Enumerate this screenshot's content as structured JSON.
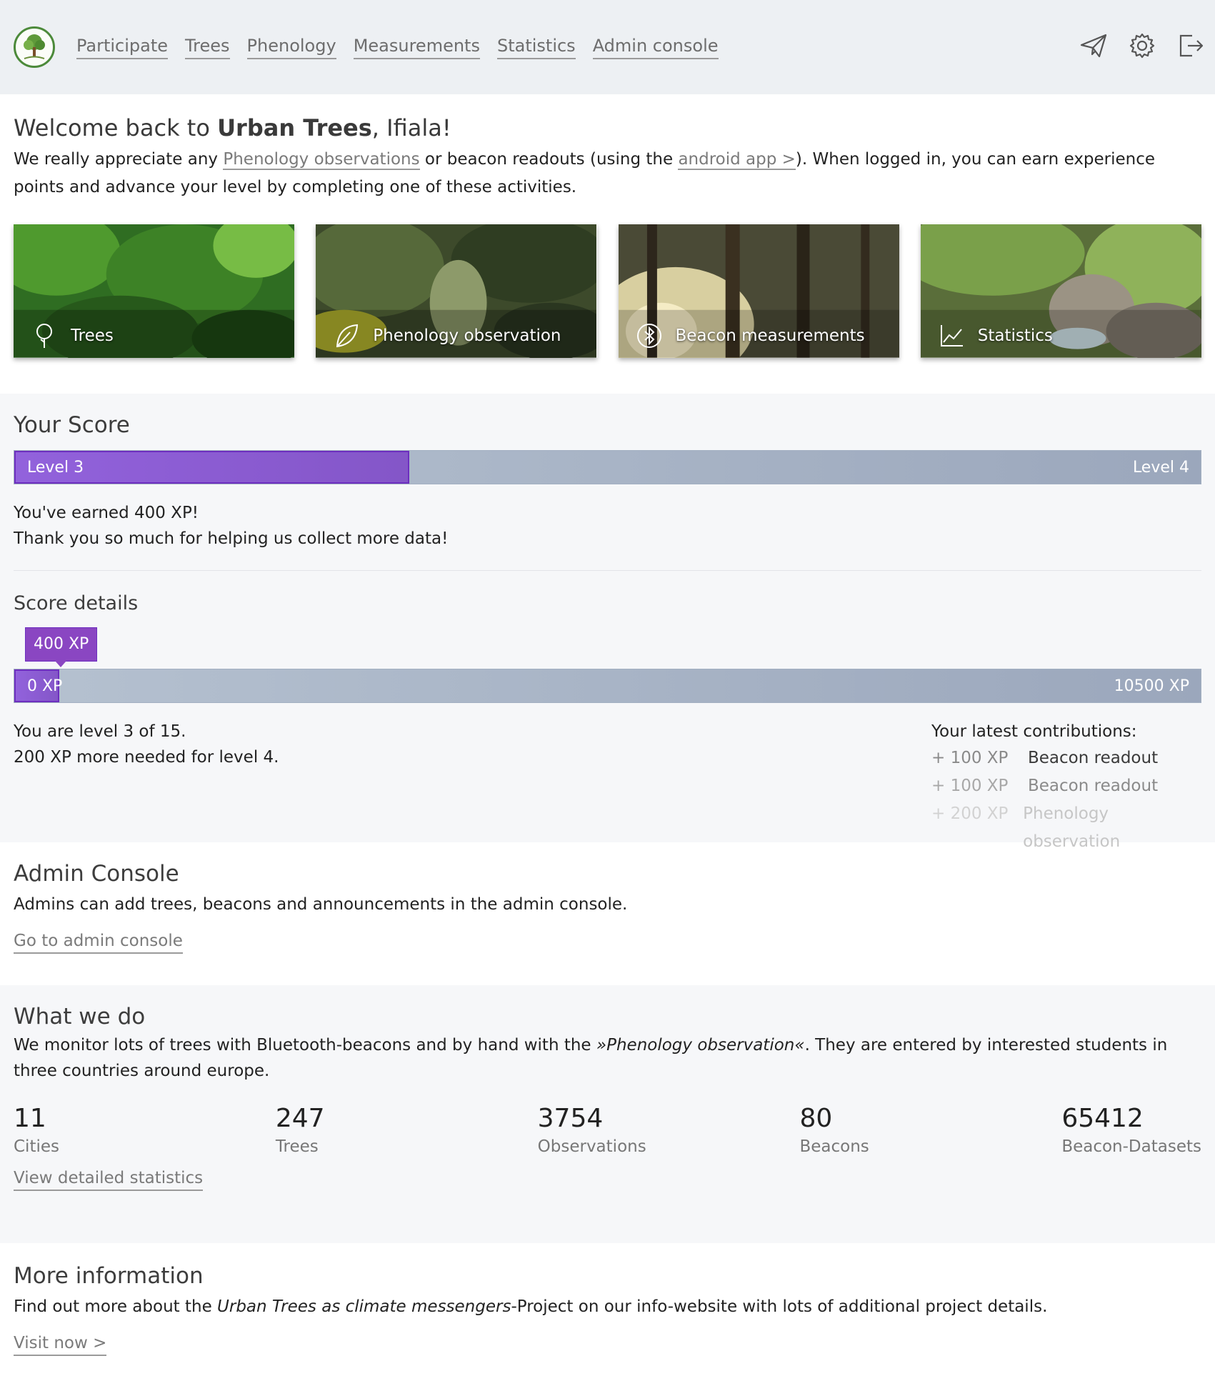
{
  "nav": {
    "items": [
      "Participate",
      "Trees",
      "Phenology",
      "Measurements",
      "Statistics",
      "Admin console"
    ]
  },
  "header_icons": [
    "send-icon",
    "settings-gear-icon",
    "logout-icon"
  ],
  "welcome": {
    "prefix": "Welcome back to ",
    "brand": "Urban Trees",
    "suffix": ", Ifiala!",
    "text_1": "We really appreciate any ",
    "link_phenology": "Phenology observations",
    "text_2": " or beacon readouts (using the ",
    "link_app": "android app >",
    "text_3": "). When logged in, you can earn experience points and advance your level by completing one of these activities."
  },
  "cards": [
    {
      "label": "Trees",
      "icon": "tree-icon"
    },
    {
      "label": "Phenology observation",
      "icon": "leaf-icon"
    },
    {
      "label": "Beacon measurements",
      "icon": "bluetooth-icon"
    },
    {
      "label": "Statistics",
      "icon": "chart-icon"
    }
  ],
  "score": {
    "title": "Your Score",
    "level_current": "Level 3",
    "level_next": "Level 4",
    "level_progress": 0.333,
    "earned": "You've earned 400 XP!",
    "thanks": "Thank you so much for helping us collect more data!"
  },
  "details": {
    "title": "Score details",
    "badge": "400 XP",
    "min_label": "0 XP",
    "max_label": "10500 XP",
    "xp_progress": 0.038,
    "level_of": "You are level 3 of 15.",
    "needed": "200 XP more needed for level 4.",
    "contrib_title": "Your latest contributions:",
    "contributions": [
      {
        "xp": "+ 100 XP",
        "label": "Beacon readout",
        "color": "#3a3a3a"
      },
      {
        "xp": "+ 100 XP",
        "label": "Beacon readout",
        "color": "#8a8a8a"
      },
      {
        "xp": "+ 200 XP",
        "label": "Phenology observation",
        "color": "#c6c6c6"
      }
    ]
  },
  "admin": {
    "title": "Admin Console",
    "text": "Admins can add trees, beacons and announcements in the admin console.",
    "link": "Go to admin console"
  },
  "what": {
    "title": "What we do",
    "text_1": "We monitor lots of trees with Bluetooth-beacons and by hand with the ",
    "text_em": "»Phenology observation«",
    "text_2": ". They are entered by interested students in three countries around europe.",
    "stats": [
      {
        "value": "11",
        "label": "Cities"
      },
      {
        "value": "247",
        "label": "Trees"
      },
      {
        "value": "3754",
        "label": "Observations"
      },
      {
        "value": "80",
        "label": "Beacons"
      },
      {
        "value": "65412",
        "label": "Beacon-Datasets"
      }
    ],
    "link": "View detailed statistics"
  },
  "more": {
    "title": "More information",
    "text_1": "Find out more about the ",
    "text_em": "Urban Trees as climate messengers",
    "text_2": "-Project on our info-website with lots of additional project details.",
    "link": "Visit now >"
  },
  "colors": {
    "accent_purple": "#8a46c2",
    "bar_gray": "#a8b4c6",
    "header_bg": "#edf0f3"
  }
}
